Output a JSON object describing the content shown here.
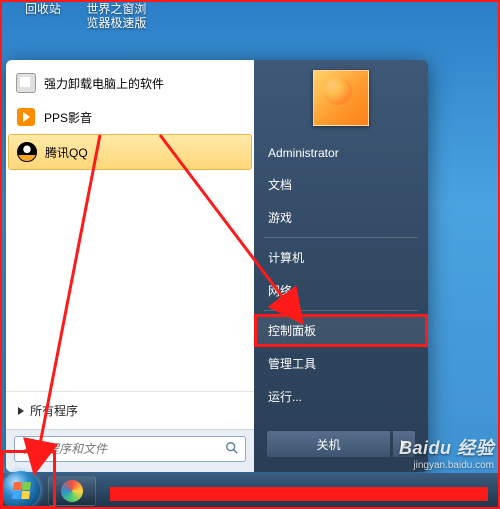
{
  "desktop_icons": {
    "recycle_bin": "回收站",
    "browser1": "世界之窗浏",
    "browser2": "览器极速版"
  },
  "start_menu": {
    "programs": {
      "uninstall": "强力卸载电脑上的软件",
      "pps": "PPS影音",
      "qq": "腾讯QQ"
    },
    "all_programs": "所有程序",
    "search_placeholder": "搜索程序和文件",
    "right": {
      "user": "Administrator",
      "documents": "文档",
      "games": "游戏",
      "computer": "计算机",
      "network": "网络",
      "control_panel": "控制面板",
      "admin_tools": "管理工具",
      "run": "运行..."
    },
    "shutdown": "关机"
  },
  "watermark": {
    "brand": "Baidu 经验",
    "url": "jingyan.baidu.com"
  }
}
